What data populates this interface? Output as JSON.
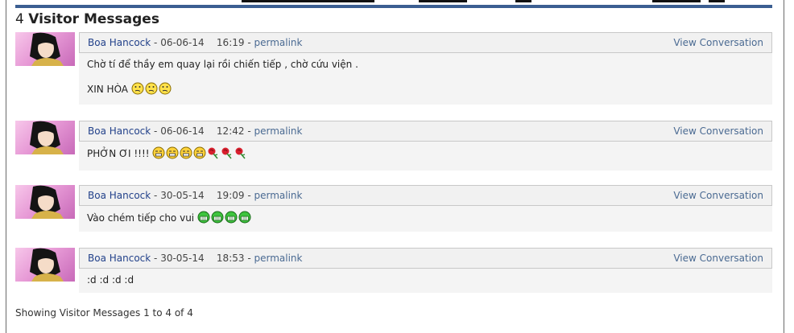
{
  "section": {
    "count": "4",
    "title": "Visitor Messages"
  },
  "messages": [
    {
      "user": "Boa Hancock",
      "date": "06-06-14",
      "time": "16:19",
      "permalink": "permalink",
      "view": "View Conversation",
      "line1": "Chờ tí để thầy em quay lại rồi chiến tiếp , chờ cứu viện .",
      "line2": "XIN HÒA",
      "emoticons": [
        "confused-smiley-icon",
        "confused-smiley-icon",
        "confused-smiley-icon"
      ]
    },
    {
      "user": "Boa Hancock",
      "date": "06-06-14",
      "time": "12:42",
      "permalink": "permalink",
      "view": "View Conversation",
      "line1": "PHỞN ƠI !!!!",
      "emoticons": [
        "grin-smiley-icon",
        "grin-smiley-icon",
        "grin-smiley-icon",
        "grin-smiley-icon",
        "rose-icon",
        "rose-icon",
        "rose-icon"
      ]
    },
    {
      "user": "Boa Hancock",
      "date": "30-05-14",
      "time": "19:09",
      "permalink": "permalink",
      "view": "View Conversation",
      "line1": "Vào chém tiếp cho vui",
      "emoticons": [
        "big-grin-icon",
        "big-grin-icon",
        "big-grin-icon",
        "big-grin-icon"
      ]
    },
    {
      "user": "Boa Hancock",
      "date": "30-05-14",
      "time": "18:53",
      "permalink": "permalink",
      "view": "View Conversation",
      "line1": ":d :d :d :d",
      "emoticons": []
    }
  ],
  "separator": " - ",
  "footer": "Showing Visitor Messages 1 to 4 of 4",
  "colors": {
    "accent_bar": "#3b5e91",
    "username": "#22418a",
    "link": "#4a6a92"
  }
}
